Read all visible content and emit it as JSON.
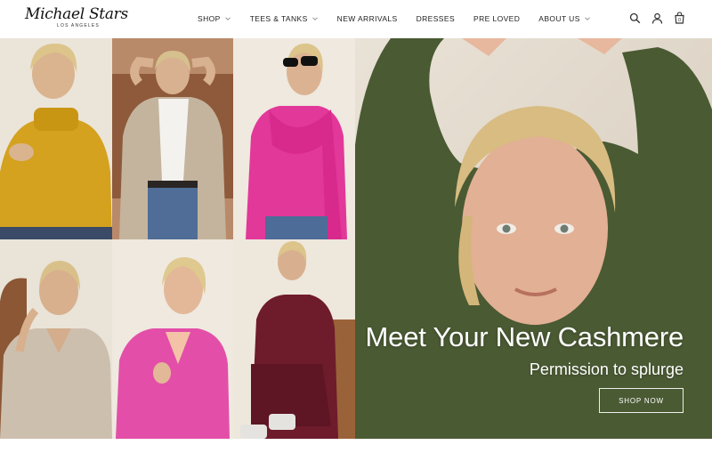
{
  "brand": {
    "logo_script": "Michael Stars",
    "logo_sub": "LOS ANGELES"
  },
  "nav": {
    "items": [
      {
        "label": "SHOP",
        "has_dropdown": true
      },
      {
        "label": "TEES & TANKS",
        "has_dropdown": true
      },
      {
        "label": "NEW ARRIVALS",
        "has_dropdown": false
      },
      {
        "label": "DRESSES",
        "has_dropdown": false
      },
      {
        "label": "PRE LOVED",
        "has_dropdown": false
      },
      {
        "label": "ABOUT US",
        "has_dropdown": true
      }
    ]
  },
  "header_icons": {
    "search": "search-icon",
    "account": "user-icon",
    "cart": "cart-icon",
    "cart_count": "0"
  },
  "hero": {
    "title": "Meet Your New Cashmere",
    "subtitle": "Permission to splurge",
    "cta_label": "SHOP NOW"
  },
  "photos": [
    {
      "sweater": "mustard turtleneck",
      "color": "#d4a21f"
    },
    {
      "sweater": "oatmeal cardigan",
      "color": "#c4b49d"
    },
    {
      "sweater": "pink sweater tied over shoulders",
      "color": "#e2389a"
    },
    {
      "sweater": "beige v-neck",
      "color": "#cdbfae"
    },
    {
      "sweater": "pink wrap cardigan",
      "color": "#e34fa8"
    },
    {
      "sweater": "burgundy set",
      "color": "#6e1b2c"
    },
    {
      "sweater": "olive green crewneck",
      "color": "#4a5a33"
    }
  ]
}
